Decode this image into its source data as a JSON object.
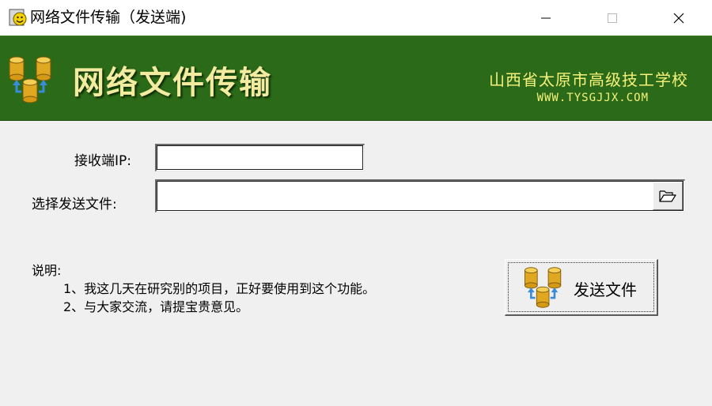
{
  "window": {
    "title": "网络文件传输（发送端)",
    "controls": [
      "minimize-icon",
      "maximize-icon",
      "close-icon"
    ]
  },
  "banner": {
    "title": "网络文件传输",
    "school_name": "山西省太原市高级技工学校",
    "school_url": "WWW.TYSGJJX.COM",
    "icon": "database-transfer-icon"
  },
  "form": {
    "ip_label": "接收端IP:",
    "ip_value": "",
    "file_label": "选择发送文件:",
    "file_value": "",
    "browse_icon": "folder-open-icon"
  },
  "description": {
    "heading": "说明:",
    "lines": [
      "1、我这几天在研究别的项目，正好要使用到这个功能。",
      "2、与大家交流，请提宝贵意见。"
    ]
  },
  "send_button": {
    "label": "发送文件",
    "icon": "database-transfer-icon"
  },
  "colors": {
    "banner_bg": "#2b6a18",
    "banner_title": "#f2eba0",
    "banner_text": "#f7f27a",
    "window_bg": "#f0f0f0"
  }
}
